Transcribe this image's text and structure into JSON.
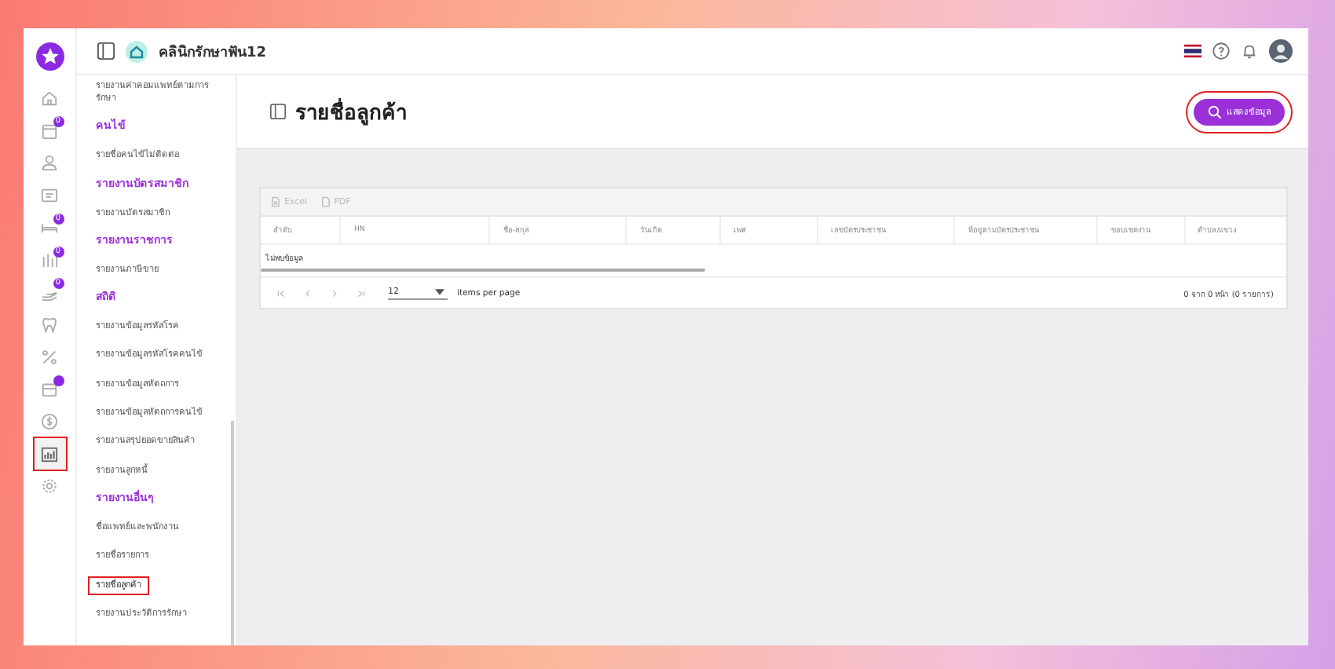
{
  "header": {
    "clinic_name": "คลินิกรักษาฟัน12"
  },
  "rail": [
    {
      "kind": "home",
      "dot": false,
      "selected": false
    },
    {
      "kind": "calendar",
      "badge": "0",
      "dot": false,
      "selected": false
    },
    {
      "kind": "person",
      "dot": false,
      "selected": false
    },
    {
      "kind": "card",
      "dot": false,
      "selected": false
    },
    {
      "kind": "bed",
      "badge": "0",
      "dot": false,
      "selected": false
    },
    {
      "kind": "bars",
      "badge": "0",
      "dot": false,
      "selected": false
    },
    {
      "kind": "hand",
      "badge": "0",
      "dot": false,
      "selected": false
    },
    {
      "kind": "tooth",
      "dot": false,
      "selected": false
    },
    {
      "kind": "percent",
      "dot": false,
      "selected": false
    },
    {
      "kind": "box",
      "dot": true,
      "selected": false
    },
    {
      "kind": "coin",
      "dot": false,
      "selected": false
    },
    {
      "kind": "chart",
      "dot": false,
      "selected": true
    },
    {
      "kind": "gear",
      "dot": false,
      "selected": false
    }
  ],
  "sidebar": {
    "sections": [
      {
        "items": [
          {
            "label": "รายงานค่าคอมแพทย์ตามการรักษา",
            "selected": false
          }
        ]
      },
      {
        "title": "คนไข้",
        "items": [
          {
            "label": "รายชื่อคนไข้ไม่ติดต่อ",
            "selected": false
          }
        ]
      },
      {
        "title": "รายงานบัตรสมาชิก",
        "items": [
          {
            "label": "รายงานบัตรสมาชิก",
            "selected": false
          }
        ]
      },
      {
        "title": "รายงานราชการ",
        "items": [
          {
            "label": "รายงานภาษีขาย",
            "selected": false
          }
        ]
      },
      {
        "title": "สถิติ",
        "items": [
          {
            "label": "รายงานข้อมูลรหัสโรค",
            "selected": false
          },
          {
            "label": "รายงานข้อมูลรหัสโรคคนไข้",
            "selected": false
          },
          {
            "label": "รายงานข้อมูลหัตถการ",
            "selected": false
          },
          {
            "label": "รายงานข้อมูลหัตถการคนไข้",
            "selected": false
          },
          {
            "label": "รายงานสรุปยอดขายสินค้า",
            "selected": false
          },
          {
            "label": "รายงานลูกหนี้",
            "selected": false
          }
        ]
      },
      {
        "title": "รายงานอื่นๆ",
        "items": [
          {
            "label": "ชื่อแพทย์และพนักงาน",
            "selected": false
          },
          {
            "label": "รายชื่อรายการ",
            "selected": false
          },
          {
            "label": "รายชื่อลูกค้า",
            "selected": true
          },
          {
            "label": "รายงานประวัติการรักษา",
            "selected": false
          }
        ]
      }
    ]
  },
  "page": {
    "title": "รายชื่อลูกค้า",
    "show_button": {
      "label": "แสดงข้อมูล",
      "highlighted": true
    }
  },
  "table": {
    "exports": [
      {
        "kind": "excel",
        "label": "Excel"
      },
      {
        "kind": "pdf",
        "label": "PDF"
      }
    ],
    "columns": [
      "ลำดับ",
      "HN",
      "ชื่อ-สกุล",
      "วันเกิด",
      "เพศ",
      "เลขบัตรประชาชน",
      "ที่อยู่ตามบัตรประชาชน",
      "ขอบเขตงาน",
      "ตำบล/แขวง"
    ],
    "empty_message": "ไม่พบข้อมูล",
    "pager": {
      "page_size": "12",
      "page_size_label": "items per page",
      "summary": "0 จาก 0 หน้า (0 รายการ)"
    }
  }
}
